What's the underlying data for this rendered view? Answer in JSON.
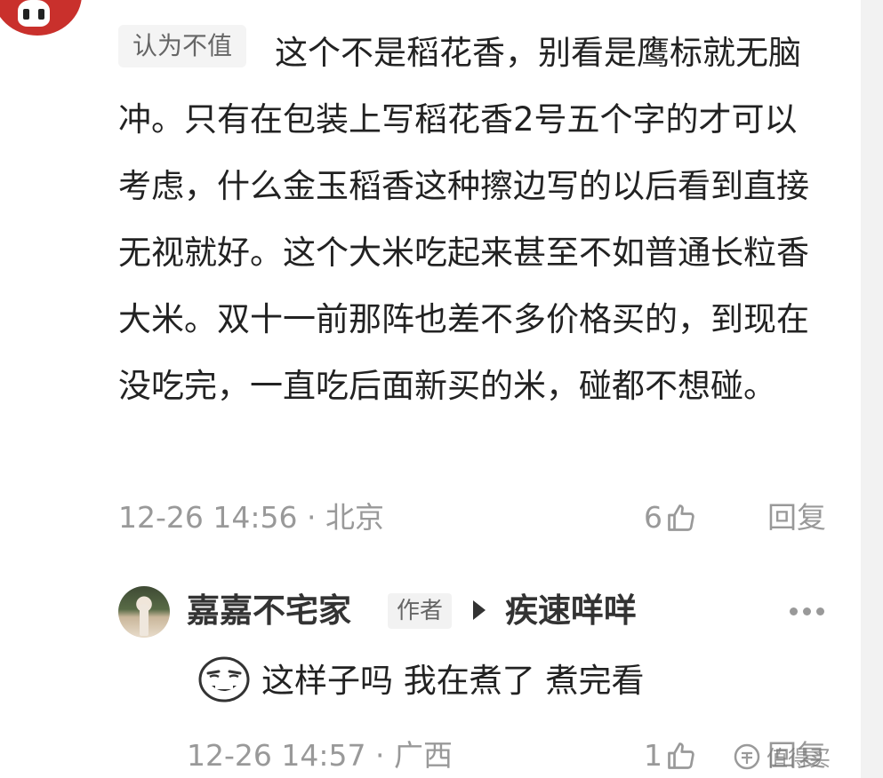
{
  "comment": {
    "badge": "认为不值",
    "text": "这个不是稻花香，别看是鹰标就无脑冲。只有在包装上写稻花香2号五个字的才可以考虑，什么金玉稻香这种擦边写的以后看到直接无视就好。这个大米吃起来甚至不如普通长粒香大米。双十一前那阵也差不多价格买的，到现在没吃完，一直吃后面新买的米，碰都不想碰。",
    "meta": "12-26 14:56 · 北京",
    "like_count": "6",
    "reply_label": "回复"
  },
  "reply": {
    "author": "嘉嘉不宅家",
    "author_tag": "作者",
    "target": "疾速咩咩",
    "text": "这样子吗 我在煮了 煮完看",
    "meta": "12-26 14:57 · 广西",
    "like_count": "1",
    "reply_label": "回复"
  },
  "watermark": "值得买",
  "icons": {
    "like": "thumbs-up-icon",
    "more": "more-dots-icon",
    "emoji": "smirk-face-emoji-icon",
    "reply_arrow": "play-arrow-icon",
    "watermark_logo": "smzdm-logo-icon"
  },
  "colors": {
    "text_primary": "#222222",
    "text_secondary": "#999999",
    "badge_bg": "#f4f4f4",
    "avatar_red": "#c9302c"
  }
}
